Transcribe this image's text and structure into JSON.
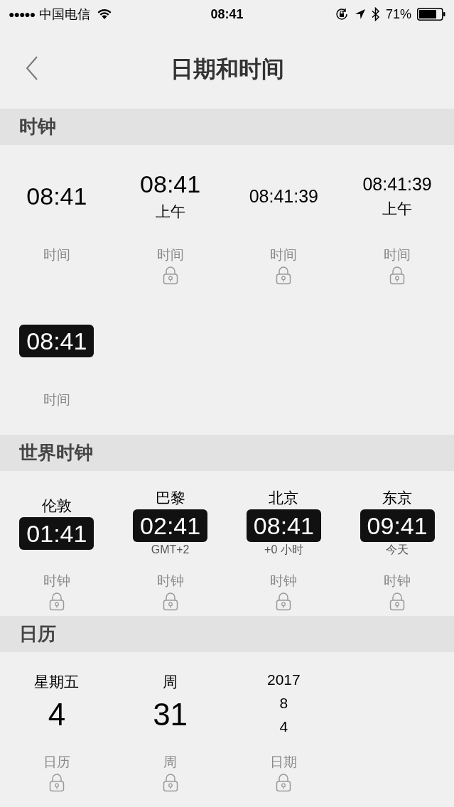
{
  "status_bar": {
    "signal_dots": "●●●●●",
    "carrier": "中国电信",
    "time": "08:41",
    "battery_percent": "71%"
  },
  "nav": {
    "title": "日期和时间"
  },
  "sections": [
    {
      "title": "时钟",
      "widgets": [
        {
          "lines": [
            {
              "kind": "large",
              "text": "08:41"
            }
          ],
          "caption": "时间",
          "locked": false
        },
        {
          "lines": [
            {
              "kind": "large",
              "text": "08:41"
            },
            {
              "kind": "label",
              "text": "上午"
            }
          ],
          "caption": "时间",
          "locked": true
        },
        {
          "lines": [
            {
              "kind": "medium",
              "text": "08:41:39"
            }
          ],
          "caption": "时间",
          "locked": true
        },
        {
          "lines": [
            {
              "kind": "medium",
              "text": "08:41:39"
            },
            {
              "kind": "label",
              "text": "上午"
            }
          ],
          "caption": "时间",
          "locked": true
        },
        {
          "lines": [
            {
              "kind": "boxed",
              "text": "08:41"
            }
          ],
          "caption": "时间",
          "locked": false
        }
      ]
    },
    {
      "title": "世界时钟",
      "widgets": [
        {
          "lines": [
            {
              "kind": "label",
              "text": "伦敦"
            },
            {
              "kind": "boxed",
              "text": "01:41"
            }
          ],
          "caption": "时钟",
          "locked": true
        },
        {
          "lines": [
            {
              "kind": "label",
              "text": "巴黎"
            },
            {
              "kind": "boxed",
              "text": "02:41"
            },
            {
              "kind": "sub",
              "text": "GMT+2"
            }
          ],
          "caption": "时钟",
          "locked": true
        },
        {
          "lines": [
            {
              "kind": "label",
              "text": "北京"
            },
            {
              "kind": "boxed",
              "text": "08:41"
            },
            {
              "kind": "sub",
              "text": "+0 小时"
            }
          ],
          "caption": "时钟",
          "locked": true
        },
        {
          "lines": [
            {
              "kind": "label",
              "text": "东京"
            },
            {
              "kind": "boxed",
              "text": "09:41"
            },
            {
              "kind": "sub",
              "text": "今天"
            }
          ],
          "caption": "时钟",
          "locked": true
        }
      ]
    },
    {
      "title": "日历",
      "widgets": [
        {
          "lines": [
            {
              "kind": "label",
              "text": "星期五"
            },
            {
              "kind": "huge",
              "text": "4"
            }
          ],
          "caption": "日历",
          "locked": true
        },
        {
          "lines": [
            {
              "kind": "label",
              "text": "周"
            },
            {
              "kind": "huge",
              "text": "31"
            }
          ],
          "caption": "周",
          "locked": true
        },
        {
          "lines": [
            {
              "kind": "label",
              "text": "2017"
            },
            {
              "kind": "label",
              "text": "8"
            },
            {
              "kind": "label",
              "text": "4"
            }
          ],
          "caption": "日期",
          "locked": true
        }
      ]
    }
  ]
}
